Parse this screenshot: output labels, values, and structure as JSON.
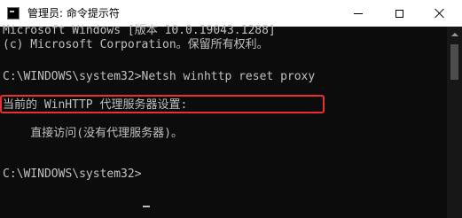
{
  "window": {
    "title": "管理员: 命令提示符",
    "icon": "cmd-icon",
    "controls": [
      "minimize-icon",
      "maximize-icon",
      "close-icon"
    ]
  },
  "console": {
    "lines": [
      "Microsoft Windows [版本 10.0.19043.1288]",
      "(c) Microsoft Corporation。保留所有权利。",
      "C:\\WINDOWS\\system32>Netsh winhttp reset proxy",
      "当前的 WinHTTP 代理服务器设置:",
      "    直接访问(没有代理服务器)。",
      "C:\\WINDOWS\\system32>"
    ]
  },
  "colors": {
    "console_background": "#0c0c0c",
    "console_text": "#c0c0c0",
    "highlight_border": "#e8302f",
    "titlebar_background": "#ffffff"
  }
}
